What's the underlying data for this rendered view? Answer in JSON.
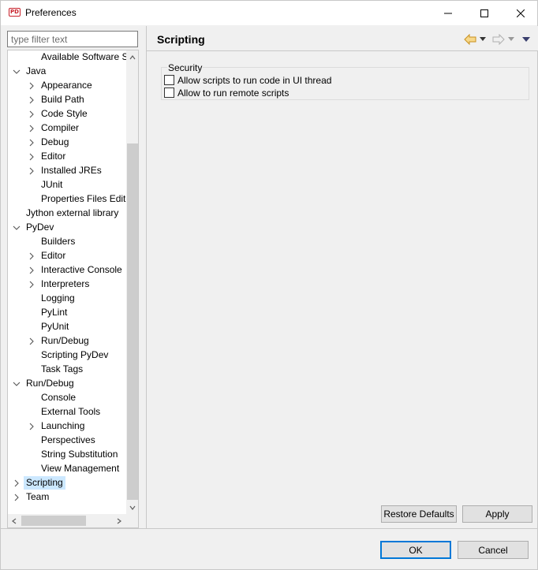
{
  "window": {
    "title": "Preferences",
    "app_icon_text": "PD"
  },
  "filter": {
    "placeholder": "type filter text"
  },
  "tree": {
    "items": [
      {
        "label": "Available Software S",
        "level": 2,
        "expander": "none"
      },
      {
        "label": "Java",
        "level": 0,
        "expander": "expanded"
      },
      {
        "label": "Appearance",
        "level": 1,
        "expander": "collapsed"
      },
      {
        "label": "Build Path",
        "level": 1,
        "expander": "collapsed"
      },
      {
        "label": "Code Style",
        "level": 1,
        "expander": "collapsed"
      },
      {
        "label": "Compiler",
        "level": 1,
        "expander": "collapsed"
      },
      {
        "label": "Debug",
        "level": 1,
        "expander": "collapsed"
      },
      {
        "label": "Editor",
        "level": 1,
        "expander": "collapsed"
      },
      {
        "label": "Installed JREs",
        "level": 1,
        "expander": "collapsed"
      },
      {
        "label": "JUnit",
        "level": 1,
        "expander": "none"
      },
      {
        "label": "Properties Files Edito",
        "level": 1,
        "expander": "none"
      },
      {
        "label": "Jython external library",
        "level": 0,
        "expander": "none"
      },
      {
        "label": "PyDev",
        "level": 0,
        "expander": "expanded"
      },
      {
        "label": "Builders",
        "level": 1,
        "expander": "none"
      },
      {
        "label": "Editor",
        "level": 1,
        "expander": "collapsed"
      },
      {
        "label": "Interactive Console",
        "level": 1,
        "expander": "collapsed"
      },
      {
        "label": "Interpreters",
        "level": 1,
        "expander": "collapsed"
      },
      {
        "label": "Logging",
        "level": 1,
        "expander": "none"
      },
      {
        "label": "PyLint",
        "level": 1,
        "expander": "none"
      },
      {
        "label": "PyUnit",
        "level": 1,
        "expander": "none"
      },
      {
        "label": "Run/Debug",
        "level": 1,
        "expander": "collapsed"
      },
      {
        "label": "Scripting PyDev",
        "level": 1,
        "expander": "none"
      },
      {
        "label": "Task Tags",
        "level": 1,
        "expander": "none"
      },
      {
        "label": "Run/Debug",
        "level": 0,
        "expander": "expanded"
      },
      {
        "label": "Console",
        "level": 1,
        "expander": "none"
      },
      {
        "label": "External Tools",
        "level": 1,
        "expander": "none"
      },
      {
        "label": "Launching",
        "level": 1,
        "expander": "collapsed"
      },
      {
        "label": "Perspectives",
        "level": 1,
        "expander": "none"
      },
      {
        "label": "String Substitution",
        "level": 1,
        "expander": "none"
      },
      {
        "label": "View Management",
        "level": 1,
        "expander": "none"
      },
      {
        "label": "Scripting",
        "level": 0,
        "expander": "collapsed",
        "selected": true
      },
      {
        "label": "Team",
        "level": 0,
        "expander": "collapsed"
      }
    ]
  },
  "page": {
    "title": "Scripting",
    "security_group": {
      "title": "Security",
      "options": [
        {
          "label": "Allow scripts to run code in UI thread",
          "checked": false
        },
        {
          "label": "Allow to run remote scripts",
          "checked": false
        }
      ]
    },
    "restore_defaults_label": "Restore Defaults",
    "apply_label": "Apply"
  },
  "footer": {
    "ok_label": "OK",
    "cancel_label": "Cancel"
  },
  "colors": {
    "selection": "#cce8ff",
    "default_button_border": "#0078d7",
    "back_arrow": "#e8b84a"
  }
}
